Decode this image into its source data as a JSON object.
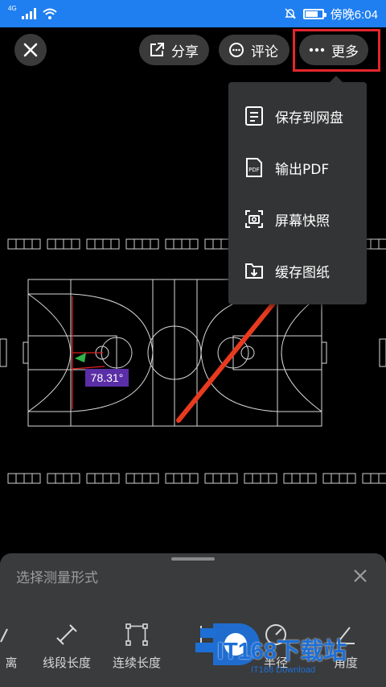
{
  "status_bar": {
    "network": "4G",
    "time": "傍晚6:04",
    "icons": [
      "signal-icon",
      "wifi-icon",
      "mute-icon",
      "battery-icon"
    ],
    "battery_level": 0.75
  },
  "toolbar": {
    "share_label": "分享",
    "comment_label": "评论",
    "more_label": "更多",
    "highlight_color": "#e4262c"
  },
  "more_menu": {
    "items": [
      {
        "label": "保存到网盘",
        "icon": "save-to-disk-icon"
      },
      {
        "label": "输出PDF",
        "icon": "pdf-icon"
      },
      {
        "label": "屏幕快照",
        "icon": "screenshot-icon"
      },
      {
        "label": "缓存图纸",
        "icon": "cache-download-icon"
      }
    ]
  },
  "drawing": {
    "angle_label": "78.31°",
    "arrow_color": "#e83a1f",
    "angle_label_color": "#5a2ea6"
  },
  "measure_sheet": {
    "title": "选择测量形式",
    "tools": [
      {
        "label": "离",
        "icon": "distance-icon"
      },
      {
        "label": "线段长度",
        "icon": "segment-length-icon"
      },
      {
        "label": "连续长度",
        "icon": "continuous-length-icon"
      },
      {
        "label": "",
        "icon": "area-icon"
      },
      {
        "label": "半径",
        "icon": "radius-icon"
      },
      {
        "label": "角度",
        "icon": "angle-icon"
      }
    ]
  },
  "watermark": {
    "text": "IT168下载站",
    "sub": "IT168 Download"
  }
}
